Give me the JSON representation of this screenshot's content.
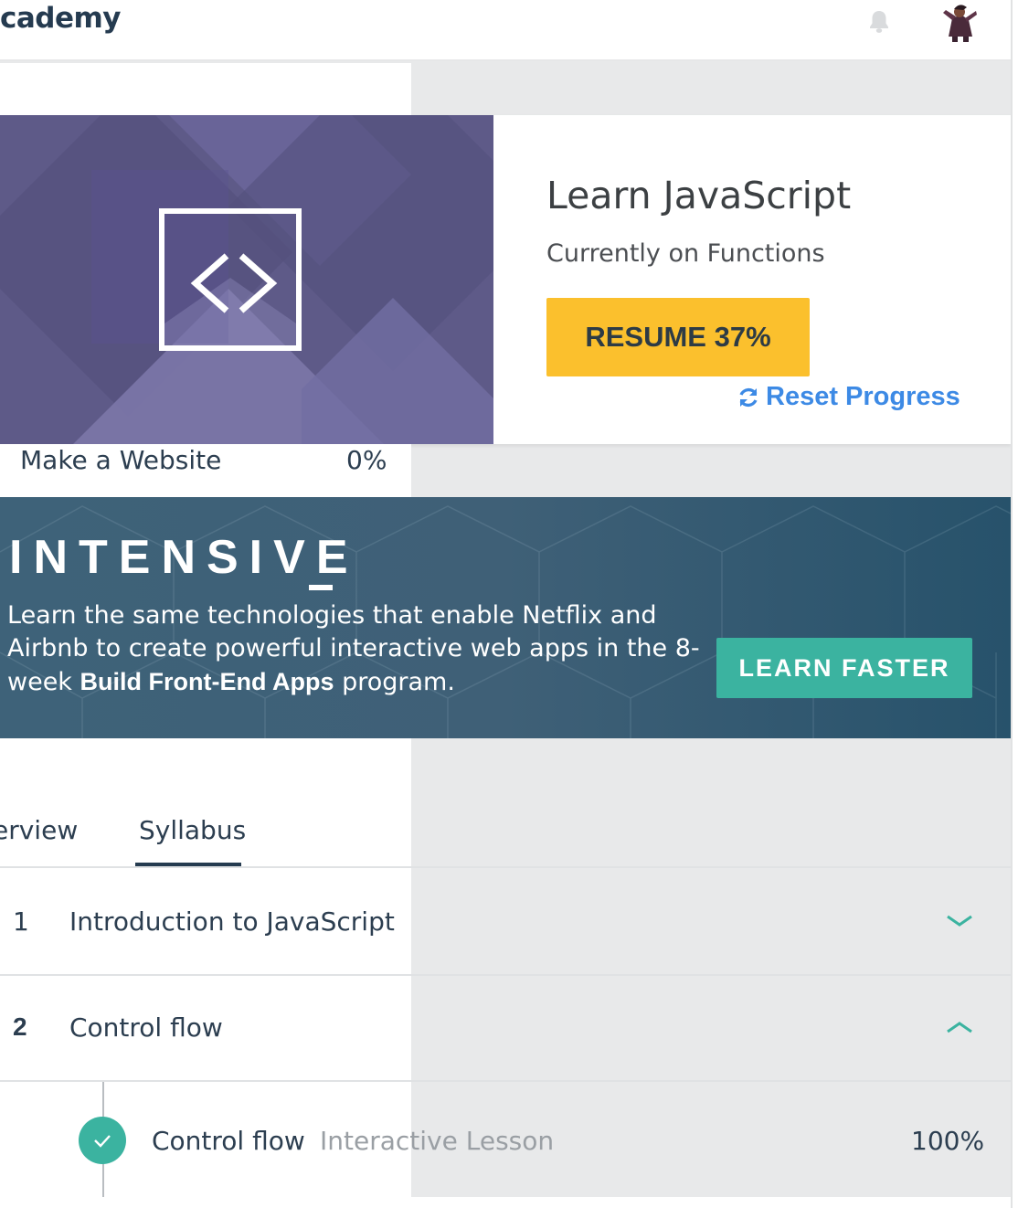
{
  "header": {
    "logo": "cademy",
    "bell_icon": "bell-icon",
    "avatar_icon": "avatar-icon"
  },
  "course_card": {
    "icon": "code-brackets-icon",
    "title": "Learn JavaScript",
    "subtitle": "Currently on Functions",
    "resume_label": "RESUME 37%",
    "reset_icon": "refresh-icon",
    "reset_label": "Reset Progress",
    "colors": {
      "resume": "#fbc02d",
      "reset": "#3d8ae5"
    }
  },
  "other_course": {
    "label": "Make a Website",
    "progress": "0%"
  },
  "banner": {
    "title": "INTENSIVE",
    "text_before": "Learn the same technologies that enable Netflix and Airbnb to create powerful interactive web apps in the 8-week ",
    "text_bold": "Build Front-End Apps",
    "text_after": " program.",
    "cta_label": "LEARN FASTER",
    "colors": {
      "cta": "#3bb3a0"
    }
  },
  "tabs": [
    {
      "label": "erview",
      "active": false
    },
    {
      "label": "Syllabus",
      "active": true
    }
  ],
  "syllabus": [
    {
      "number": "1",
      "title": "Introduction to JavaScript",
      "expanded": false,
      "chevron": "chevron-down-icon"
    },
    {
      "number": "2",
      "title": "Control flow",
      "expanded": true,
      "chevron": "chevron-up-icon"
    }
  ],
  "lesson": {
    "title": "Control flow",
    "type": "Interactive Lesson",
    "progress": "100%",
    "status_icon": "check-icon"
  }
}
